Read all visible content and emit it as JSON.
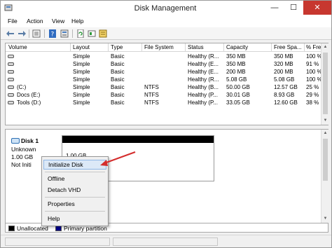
{
  "window": {
    "title": "Disk Management",
    "min_glyph": "—",
    "max_glyph": "☐",
    "close_glyph": "✕"
  },
  "menu": [
    "File",
    "Action",
    "View",
    "Help"
  ],
  "toolbar": [
    "back-icon",
    "forward-icon",
    "disk-list-icon",
    "help-icon",
    "properties-icon",
    "refresh-icon",
    "rescan-icon",
    "settings-icon"
  ],
  "list": {
    "columns": [
      "Volume",
      "Layout",
      "Type",
      "File System",
      "Status",
      "Capacity",
      "Free Spa...",
      "% Free"
    ],
    "rows": [
      {
        "volume": "",
        "layout": "Simple",
        "type": "Basic",
        "fs": "",
        "status": "Healthy (R...",
        "capacity": "350 MB",
        "free": "350 MB",
        "pct": "100 %"
      },
      {
        "volume": "",
        "layout": "Simple",
        "type": "Basic",
        "fs": "",
        "status": "Healthy (E...",
        "capacity": "350 MB",
        "free": "320 MB",
        "pct": "91 %"
      },
      {
        "volume": "",
        "layout": "Simple",
        "type": "Basic",
        "fs": "",
        "status": "Healthy (E...",
        "capacity": "200 MB",
        "free": "200 MB",
        "pct": "100 %"
      },
      {
        "volume": "",
        "layout": "Simple",
        "type": "Basic",
        "fs": "",
        "status": "Healthy (R...",
        "capacity": "5.08 GB",
        "free": "5.08 GB",
        "pct": "100 %"
      },
      {
        "volume": "(C:)",
        "layout": "Simple",
        "type": "Basic",
        "fs": "NTFS",
        "status": "Healthy (B...",
        "capacity": "50.00 GB",
        "free": "12.57 GB",
        "pct": "25 %"
      },
      {
        "volume": "Docs (E:)",
        "layout": "Simple",
        "type": "Basic",
        "fs": "NTFS",
        "status": "Healthy (P...",
        "capacity": "30.01 GB",
        "free": "8.93 GB",
        "pct": "29 %"
      },
      {
        "volume": "Tools (D:)",
        "layout": "Simple",
        "type": "Basic",
        "fs": "NTFS",
        "status": "Healthy (P...",
        "capacity": "33.05 GB",
        "free": "12.60 GB",
        "pct": "38 %"
      }
    ]
  },
  "disk": {
    "name": "Disk 1",
    "kind": "Unknown",
    "size": "1.00 GB",
    "state": "Not Initi",
    "partition_size": "1.00 GB"
  },
  "context_menu": {
    "items": [
      "Initialize Disk",
      "Offline",
      "Detach VHD",
      "Properties",
      "Help"
    ]
  },
  "legend": {
    "unallocated": "Unallocated",
    "primary": "Primary partition",
    "unallocated_color": "#000000",
    "primary_color": "#00008b"
  },
  "colors": {
    "arrow": "#d42d2d",
    "highlight": "#dce9f7"
  }
}
